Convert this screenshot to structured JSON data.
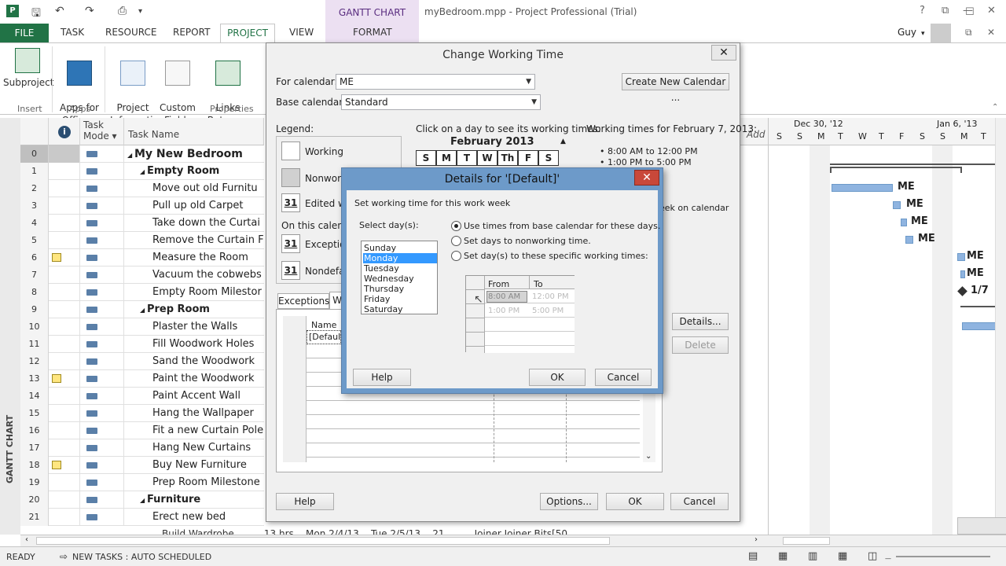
{
  "app": {
    "context_tab_group": "GANTT CHART TOOLS",
    "window_title": "myBedroom.mpp - Project Professional (Trial)",
    "user": "Guy"
  },
  "tabs": [
    "FILE",
    "TASK",
    "RESOURCE",
    "REPORT",
    "PROJECT",
    "VIEW",
    "FORMAT"
  ],
  "ribbon": {
    "buttons": [
      {
        "label": "Subproject"
      },
      {
        "label": "Apps for\nOffice ▾"
      },
      {
        "label": "Project\nInformation"
      },
      {
        "label": "Custom\nFields"
      },
      {
        "label": "Links Between\nProjects"
      }
    ],
    "groups": [
      "Insert",
      "Apps",
      "Properties"
    ]
  },
  "grid": {
    "headers": {
      "mode": "Task\nMode ▾",
      "name": "Task Name"
    },
    "rows": [
      {
        "id": "0",
        "name": "My New Bedroom",
        "level": 0,
        "summary": true,
        "note": false
      },
      {
        "id": "1",
        "name": "Empty Room",
        "level": 1,
        "summary": true,
        "note": false
      },
      {
        "id": "2",
        "name": "Move out old Furnitu",
        "level": 2,
        "summary": false,
        "note": false
      },
      {
        "id": "3",
        "name": "Pull up old Carpet",
        "level": 2,
        "summary": false,
        "note": false
      },
      {
        "id": "4",
        "name": "Take down the Curtai",
        "level": 2,
        "summary": false,
        "note": false
      },
      {
        "id": "5",
        "name": "Remove the Curtain F",
        "level": 2,
        "summary": false,
        "note": false
      },
      {
        "id": "6",
        "name": "Measure the Room",
        "level": 2,
        "summary": false,
        "note": true
      },
      {
        "id": "7",
        "name": "Vacuum the cobwebs",
        "level": 2,
        "summary": false,
        "note": false
      },
      {
        "id": "8",
        "name": "Empty Room Milestor",
        "level": 2,
        "summary": false,
        "note": false
      },
      {
        "id": "9",
        "name": "Prep Room",
        "level": 1,
        "summary": true,
        "note": false
      },
      {
        "id": "10",
        "name": "Plaster the Walls",
        "level": 2,
        "summary": false,
        "note": false
      },
      {
        "id": "11",
        "name": "Fill Woodwork Holes",
        "level": 2,
        "summary": false,
        "note": false
      },
      {
        "id": "12",
        "name": "Sand the Woodwork",
        "level": 2,
        "summary": false,
        "note": false
      },
      {
        "id": "13",
        "name": "Paint the Woodwork",
        "level": 2,
        "summary": false,
        "note": true
      },
      {
        "id": "14",
        "name": "Paint Accent Wall",
        "level": 2,
        "summary": false,
        "note": false
      },
      {
        "id": "15",
        "name": "Hang the Wallpaper",
        "level": 2,
        "summary": false,
        "note": false
      },
      {
        "id": "16",
        "name": "Fit a new Curtain Pole",
        "level": 2,
        "summary": false,
        "note": false
      },
      {
        "id": "17",
        "name": "Hang New Curtains",
        "level": 2,
        "summary": false,
        "note": false
      },
      {
        "id": "18",
        "name": "Buy New Furniture",
        "level": 2,
        "summary": false,
        "note": true
      },
      {
        "id": "19",
        "name": "Prep Room Milestone",
        "level": 2,
        "summary": false,
        "note": false
      },
      {
        "id": "20",
        "name": "Furniture",
        "level": 1,
        "summary": true,
        "note": false
      },
      {
        "id": "21",
        "name": "Erect new bed",
        "level": 2,
        "summary": false,
        "note": false
      }
    ]
  },
  "chart": {
    "add_col": "Add",
    "weeks": [
      "Dec 30, '12",
      "Jan 6, '13"
    ],
    "days": [
      "S",
      "S",
      "M",
      "T",
      "W",
      "T",
      "F",
      "S",
      "S",
      "M",
      "T"
    ],
    "labels": [
      "ME",
      "ME",
      "ME",
      "ME",
      "ME",
      "ME",
      "1/7"
    ]
  },
  "cwt": {
    "title": "Change Working Time",
    "for_calendar_label": "For calendar:",
    "for_calendar_value": "ME",
    "base_calendar_label": "Base calendar:",
    "base_calendar_value": "Standard",
    "create_new": "Create New Calendar ...",
    "legend_label": "Legend:",
    "legend": [
      "Working",
      "Nonwork",
      "Edited w",
      "On this calenda",
      "Exception",
      "Nondefa"
    ],
    "legend_num": "31",
    "click_hint": "Click on a day to see its working times:",
    "month": "February 2013",
    "weekdays": [
      "S",
      "M",
      "T",
      "W",
      "Th",
      "F",
      "S"
    ],
    "wt_title": "Working times for February 7, 2013:",
    "wt_lines": [
      "• 8:00 AM to 12:00 PM",
      "• 1:00 PM to 5:00 PM"
    ],
    "wt_partial": "eek on calendar",
    "tabs": [
      "Exceptions",
      "W"
    ],
    "table_name_col": "Name",
    "table_first": "[Default",
    "details_btn": "Details...",
    "delete_btn": "Delete",
    "help": "Help",
    "options": "Options...",
    "ok": "OK",
    "cancel": "Cancel"
  },
  "details": {
    "title": "Details for '[Default]'",
    "subtitle": "Set working time for this work week",
    "select_days": "Select day(s):",
    "days": [
      "Sunday",
      "Monday",
      "Tuesday",
      "Wednesday",
      "Thursday",
      "Friday",
      "Saturday"
    ],
    "selected_day": "Monday",
    "options": [
      "Use times from base calendar for these days.",
      "Set days to nonworking time.",
      "Set day(s) to these specific working times:"
    ],
    "from": "From",
    "to": "To",
    "times": [
      [
        "8:00 AM",
        "12:00 PM"
      ],
      [
        "1:00 PM",
        "5:00 PM"
      ]
    ],
    "help": "Help",
    "ok": "OK",
    "cancel": "Cancel"
  },
  "status": {
    "ready": "READY",
    "new_tasks": "NEW TASKS : AUTO SCHEDULED"
  },
  "partial_row": "Build Wardrobe          13 hrs    Mon 2/4/13    Tue 2/5/13    21          Joiner,Joiner,Bits[50"
}
